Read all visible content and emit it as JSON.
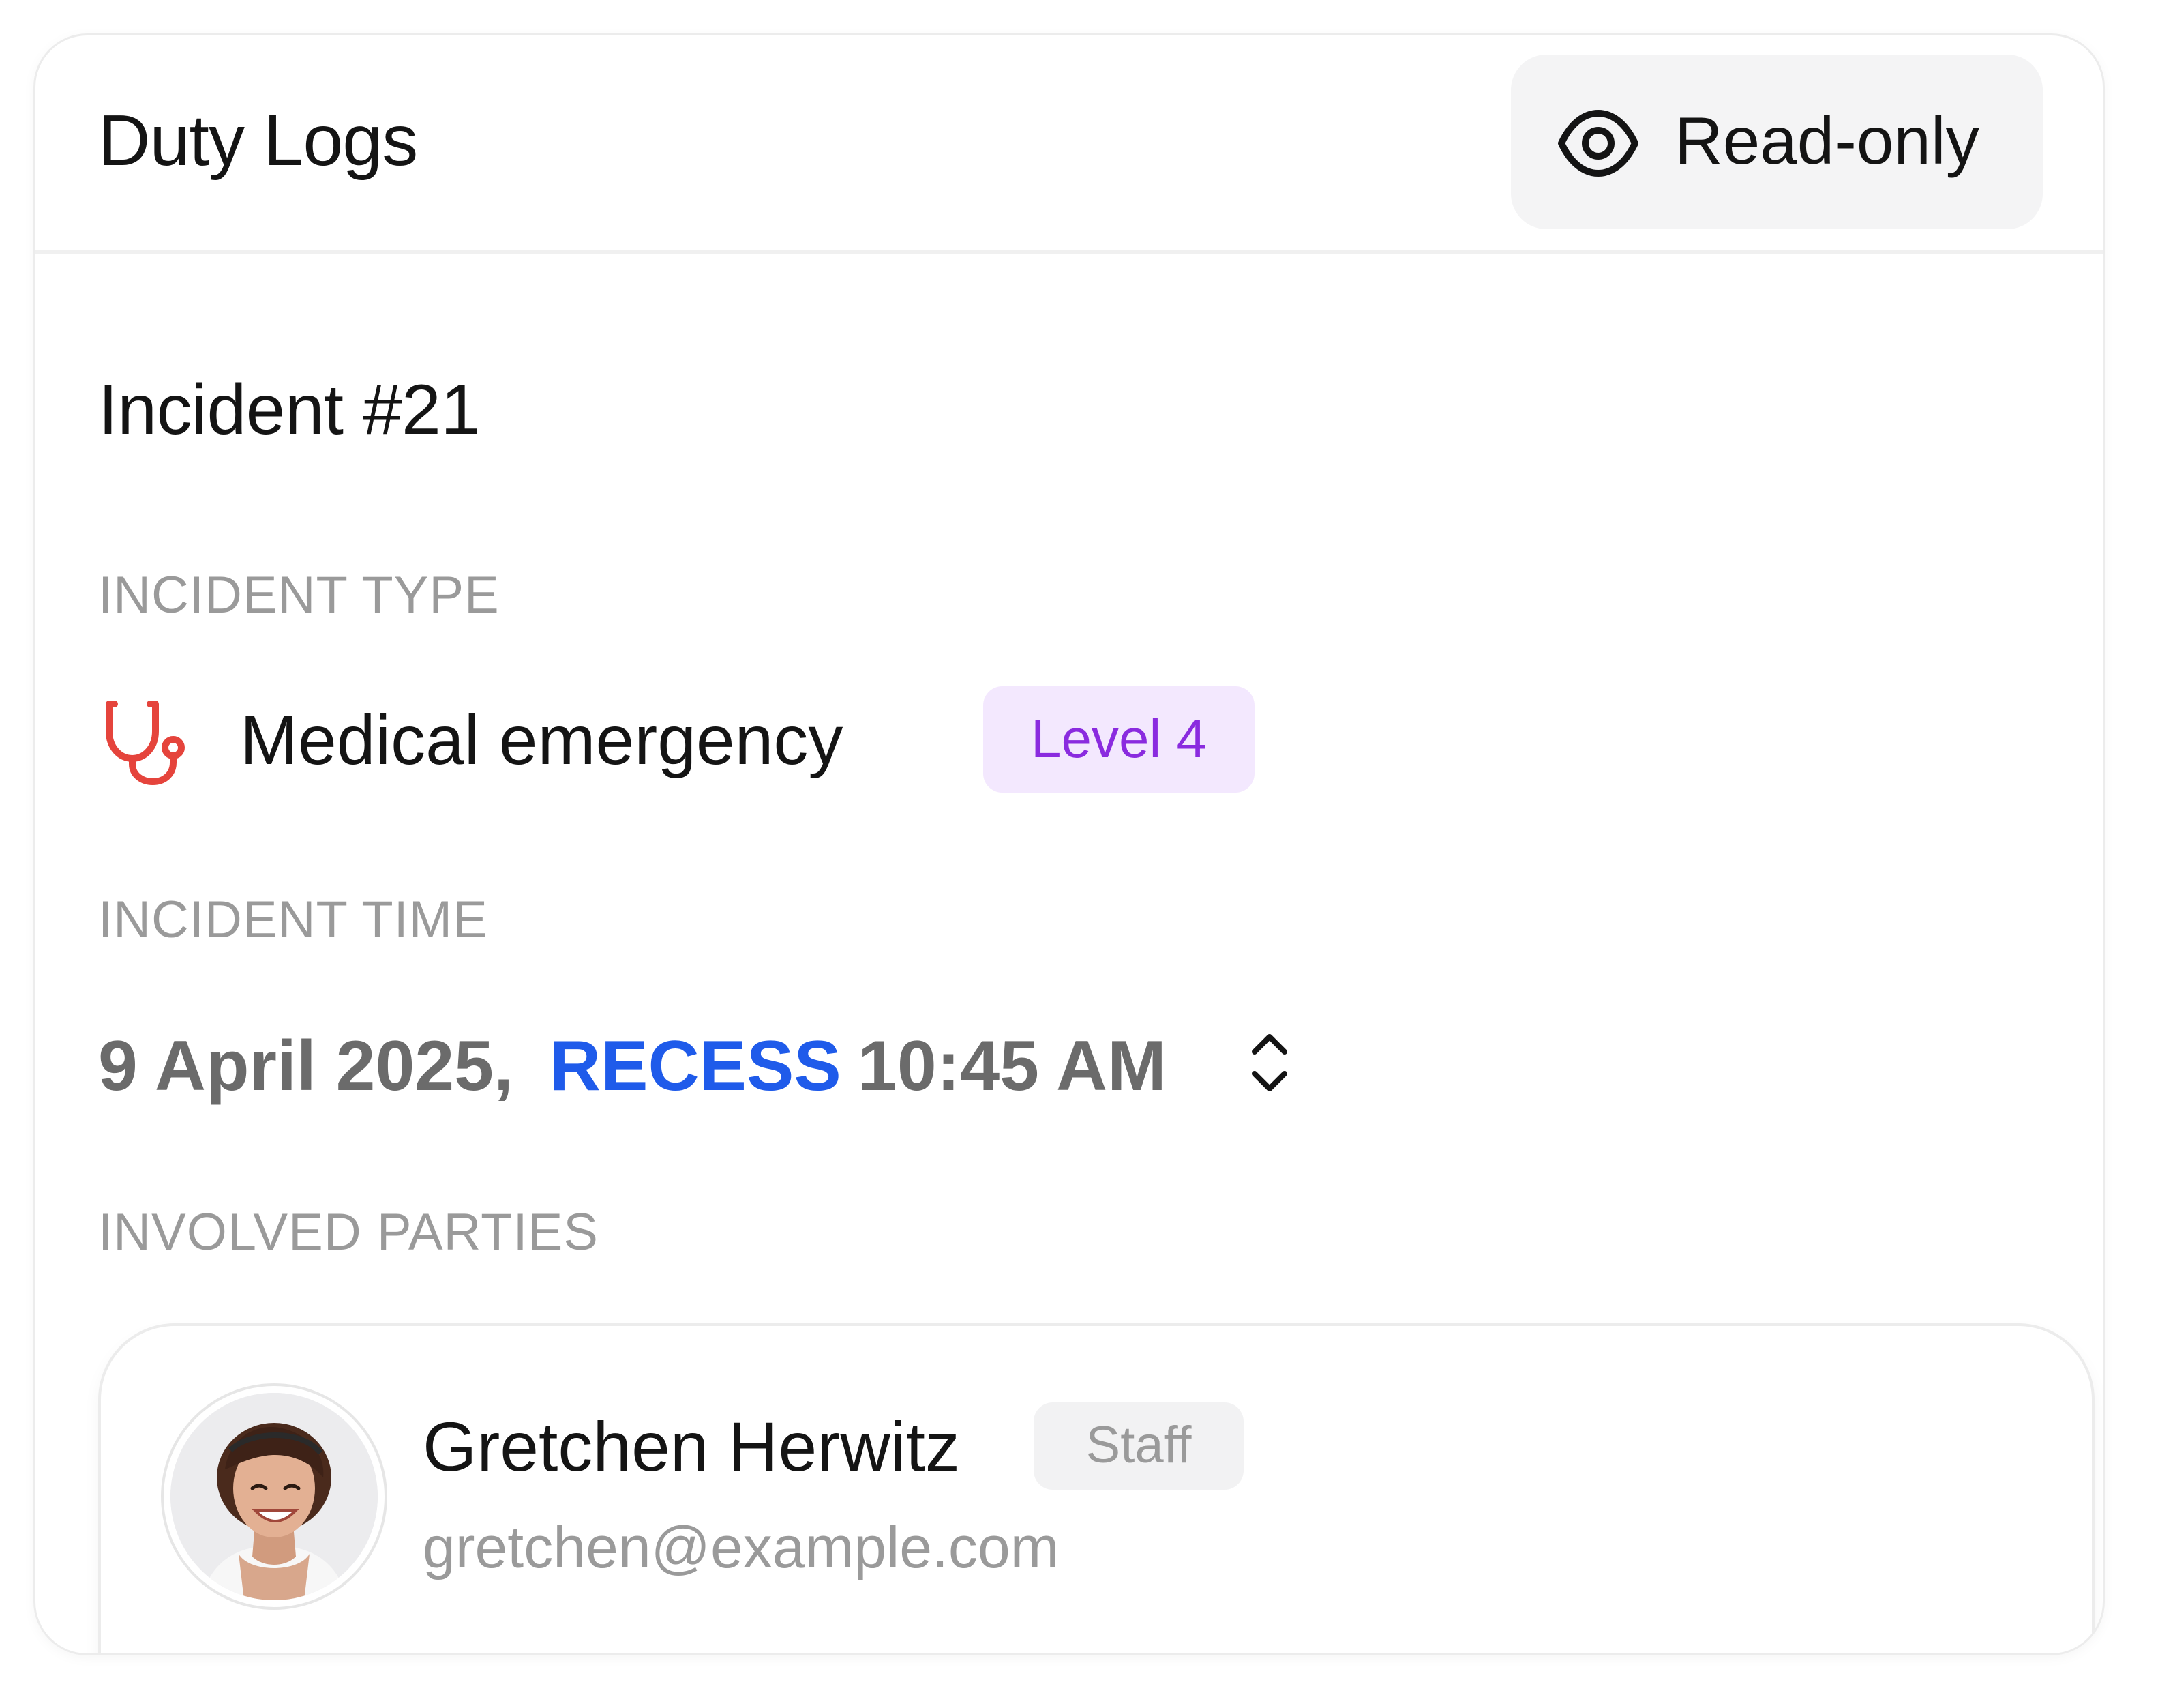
{
  "header": {
    "title": "Duty Logs",
    "mode_label": "Read-only",
    "mode_icon": "eye-icon"
  },
  "incident": {
    "title": "Incident #21",
    "type_label": "INCIDENT TYPE",
    "type_value": "Medical emergency",
    "type_icon": "stethoscope-icon",
    "level": "Level 4",
    "time_label": "INCIDENT TIME",
    "date": "9 April 2025,",
    "period": "RECESS",
    "time": "10:45 AM",
    "parties_label": "INVOLVED PARTIES"
  },
  "parties": [
    {
      "name": "Gretchen Herwitz",
      "role": "Staff",
      "email": "gretchen@example.com"
    }
  ],
  "colors": {
    "accent_blue": "#1f5bea",
    "level_purple": "#8a2bdf",
    "level_bg": "#f3e8fe",
    "icon_red": "#e5443c",
    "muted": "#9a9a9a"
  }
}
